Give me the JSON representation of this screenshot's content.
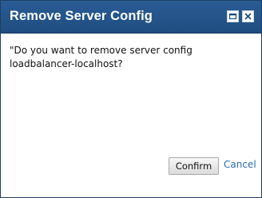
{
  "dialog": {
    "title": "Remove Server Config",
    "message": "\"Do you want to remove server config\nloadbalancer-localhost?",
    "confirm_label": "Confirm",
    "cancel_label": "Cancel"
  },
  "icons": {
    "maximize": "maximize-icon",
    "close": "close-icon"
  },
  "colors": {
    "titlebar": "#2a5c94",
    "link": "#2a6bb0"
  }
}
